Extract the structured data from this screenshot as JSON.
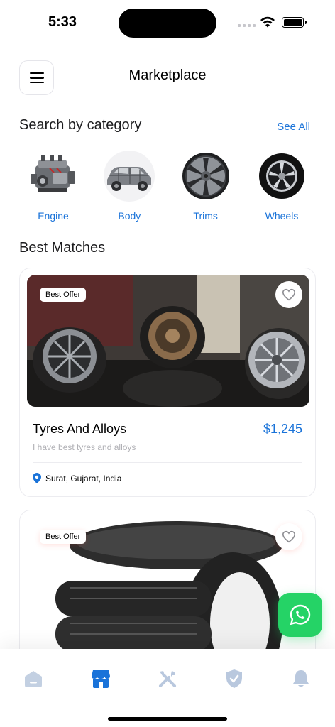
{
  "status_bar": {
    "time": "5:33"
  },
  "header": {
    "title": "Marketplace"
  },
  "categories_section": {
    "title": "Search by category",
    "see_all": "See All",
    "items": [
      {
        "label": "Engine",
        "icon": "engine-icon"
      },
      {
        "label": "Body",
        "icon": "car-body-icon"
      },
      {
        "label": "Trims",
        "icon": "trim-icon"
      },
      {
        "label": "Wheels",
        "icon": "wheel-icon"
      }
    ]
  },
  "best_matches": {
    "title": "Best Matches",
    "listings": [
      {
        "badge": "Best Offer",
        "title": "Tyres And Alloys",
        "price": "$1,245",
        "description": "I have best tyres and alloys",
        "location": "Surat, Gujarat, India"
      },
      {
        "badge": "Best Offer"
      }
    ]
  },
  "tab_bar": {
    "tabs": [
      {
        "icon": "home-icon",
        "active": false
      },
      {
        "icon": "store-icon",
        "active": true
      },
      {
        "icon": "tools-icon",
        "active": false
      },
      {
        "icon": "shield-icon",
        "active": false
      },
      {
        "icon": "bell-icon",
        "active": false
      }
    ]
  },
  "colors": {
    "accent": "#1a73d9",
    "whatsapp": "#25d366",
    "inactive_tab": "#b9c8de"
  }
}
